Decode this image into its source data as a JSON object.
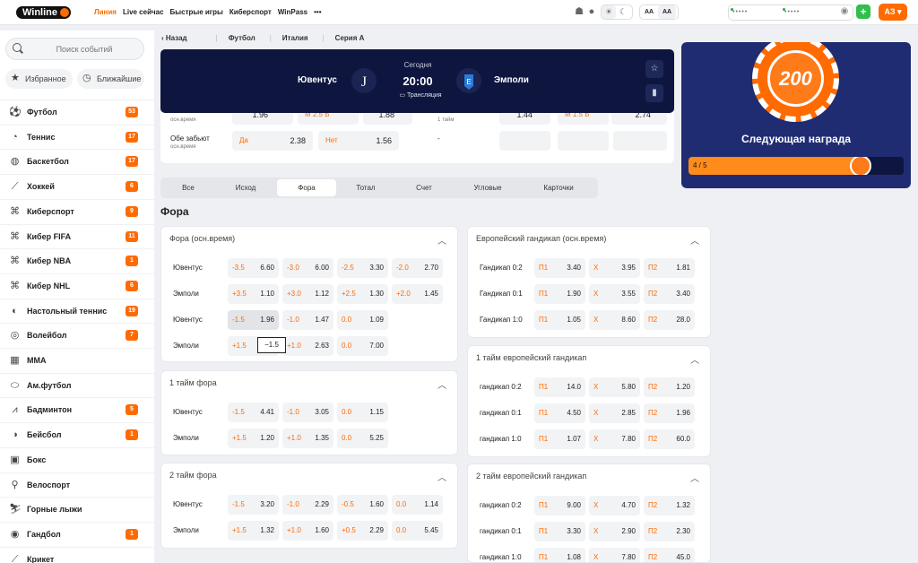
{
  "topbar": {
    "logo": "Winline",
    "nav": [
      "Линия",
      "Live сейчас",
      "Быстрые игры",
      "Киберспорт",
      "WinPass",
      "•••"
    ],
    "login_mask": "•••••",
    "password_mask": "•••••",
    "font_small": "AA",
    "font_large": "AA",
    "user": "АЗ"
  },
  "sidebar": {
    "search_placeholder": "Поиск событий",
    "favorites": "Избранное",
    "upcoming": "Ближайшие",
    "sports": [
      {
        "label": "Футбол",
        "count": "53",
        "icon": "soccer-icon"
      },
      {
        "label": "Теннис",
        "count": "17",
        "icon": "tennis-icon"
      },
      {
        "label": "Баскетбол",
        "count": "17",
        "icon": "basketball-icon"
      },
      {
        "label": "Хоккей",
        "count": "6",
        "icon": "hockey-icon"
      },
      {
        "label": "Киберспорт",
        "count": "9",
        "icon": "gamepad-icon"
      },
      {
        "label": "Кибер FIFA",
        "count": "11",
        "icon": "gamepad-icon"
      },
      {
        "label": "Кибер NBA",
        "count": "1",
        "icon": "gamepad-icon"
      },
      {
        "label": "Кибер NHL",
        "count": "6",
        "icon": "gamepad-icon"
      },
      {
        "label": "Настольный теннис",
        "count": "19",
        "icon": "table-tennis-icon"
      },
      {
        "label": "Волейбол",
        "count": "7",
        "icon": "volleyball-icon"
      },
      {
        "label": "MMA",
        "count": "",
        "icon": "mma-icon"
      },
      {
        "label": "Ам.футбол",
        "count": "",
        "icon": "american-football-icon"
      },
      {
        "label": "Бадминтон",
        "count": "5",
        "icon": "badminton-icon"
      },
      {
        "label": "Бейсбол",
        "count": "1",
        "icon": "baseball-icon"
      },
      {
        "label": "Бокс",
        "count": "",
        "icon": "boxing-icon"
      },
      {
        "label": "Велоспорт",
        "count": "",
        "icon": "bicycle-icon"
      },
      {
        "label": "Горные лыжи",
        "count": "",
        "icon": "ski-icon"
      },
      {
        "label": "Гандбол",
        "count": "1",
        "icon": "handball-icon"
      },
      {
        "label": "Крикет",
        "count": "",
        "icon": "cricket-icon"
      }
    ]
  },
  "breadcrumbs": {
    "back": "Назад",
    "items": [
      "Футбол",
      "Италия",
      "Серия А"
    ]
  },
  "match": {
    "home": "Ювентус",
    "away": "Эмполи",
    "day": "Сегодня",
    "time": "20:00",
    "stream": "Трансляция",
    "row1_label": "осн.время",
    "row1_odd1": "1.96",
    "row1_mlabel": "М 2.5 Б",
    "row1_odd2": "1.88",
    "row1_half": "1 тайм",
    "row1_odd3": "1.44",
    "row1_mlabel2": "М 1.5 Б",
    "row1_odd4": "2.74",
    "row2_label1": "Обе забьют",
    "row2_label2": "осн.время",
    "yes": "Да",
    "yes_odd": "2.38",
    "no": "Нет",
    "no_odd": "1.56",
    "dash": "-"
  },
  "promo": {
    "chip": "200",
    "next": "Следующая награда",
    "progress_label": "4 / 5",
    "progress": 0.8
  },
  "tabs": [
    "Все",
    "Исход",
    "Фора",
    "Тотал",
    "Счет",
    "Угловые",
    "Карточки"
  ],
  "section_title": "Фора",
  "handicap_main": {
    "title": "Фора (осн.время)",
    "rows": [
      {
        "team": "Ювентус",
        "cells": [
          [
            "-3.5",
            "6.60"
          ],
          [
            "-3.0",
            "6.00"
          ],
          [
            "-2.5",
            "3.30"
          ],
          [
            "-2.0",
            "2.70"
          ]
        ]
      },
      {
        "team": "Эмполи",
        "cells": [
          [
            "+3.5",
            "1.10"
          ],
          [
            "+3.0",
            "1.12"
          ],
          [
            "+2.5",
            "1.30"
          ],
          [
            "+2.0",
            "1.45"
          ]
        ]
      },
      {
        "team": "Ювентус",
        "cells": [
          [
            "-1.5",
            "1.96"
          ],
          [
            "-1.0",
            "1.47"
          ],
          [
            "0.0",
            "1.09"
          ]
        ]
      },
      {
        "team": "Эмполи",
        "cells": [
          [
            "+1.5",
            "2.90"
          ],
          [
            "+1.0",
            "2.63"
          ],
          [
            "0.0",
            "7.00"
          ]
        ]
      }
    ],
    "tooltip": "−1.5"
  },
  "handicap_h1": {
    "title": "1 тайм фора",
    "rows": [
      {
        "team": "Ювентус",
        "cells": [
          [
            "-1.5",
            "4.41"
          ],
          [
            "-1.0",
            "3.05"
          ],
          [
            "0.0",
            "1.15"
          ]
        ]
      },
      {
        "team": "Эмполи",
        "cells": [
          [
            "+1.5",
            "1.20"
          ],
          [
            "+1.0",
            "1.35"
          ],
          [
            "0.0",
            "5.25"
          ]
        ]
      }
    ]
  },
  "handicap_h2": {
    "title": "2 тайм фора",
    "rows": [
      {
        "team": "Ювентус",
        "cells": [
          [
            "-1.5",
            "3.20"
          ],
          [
            "-1.0",
            "2.29"
          ],
          [
            "-0.5",
            "1.60"
          ],
          [
            "0.0",
            "1.14"
          ]
        ]
      },
      {
        "team": "Эмполи",
        "cells": [
          [
            "+1.5",
            "1.32"
          ],
          [
            "+1.0",
            "1.60"
          ],
          [
            "+0.5",
            "2.29"
          ],
          [
            "0.0",
            "5.45"
          ]
        ]
      }
    ]
  },
  "euro_main": {
    "title": "Европейский гандикап (осн.время)",
    "rows": [
      {
        "label": "Гандикап 0:2",
        "p1": "3.40",
        "x": "3.95",
        "p2": "1.81"
      },
      {
        "label": "Гандикап 0:1",
        "p1": "1.90",
        "x": "3.55",
        "p2": "3.40"
      },
      {
        "label": "Гандикап 1:0",
        "p1": "1.05",
        "x": "8.60",
        "p2": "28.0"
      }
    ]
  },
  "euro_h1": {
    "title": "1 тайм европейский гандикап",
    "rows": [
      {
        "label": "гандикап 0:2",
        "p1": "14.0",
        "x": "5.80",
        "p2": "1.20"
      },
      {
        "label": "гандикап 0:1",
        "p1": "4.50",
        "x": "2.85",
        "p2": "1.96"
      },
      {
        "label": "гандикап 1:0",
        "p1": "1.07",
        "x": "7.80",
        "p2": "60.0"
      }
    ]
  },
  "euro_h2": {
    "title": "2 тайм европейский гандикап",
    "rows": [
      {
        "label": "гандикап 0:2",
        "p1": "9.00",
        "x": "4.70",
        "p2": "1.32"
      },
      {
        "label": "гандикап 0:1",
        "p1": "3.30",
        "x": "2.90",
        "p2": "2.30"
      },
      {
        "label": "гандикап 1:0",
        "p1": "1.08",
        "x": "7.80",
        "p2": "45.0"
      }
    ]
  },
  "euro_labels": {
    "p1": "П1",
    "x": "X",
    "p2": "П2"
  },
  "colors": {
    "accent": "#ff6b00",
    "header_bg": "#0e1640",
    "promo_bg": "#1f2c72"
  }
}
